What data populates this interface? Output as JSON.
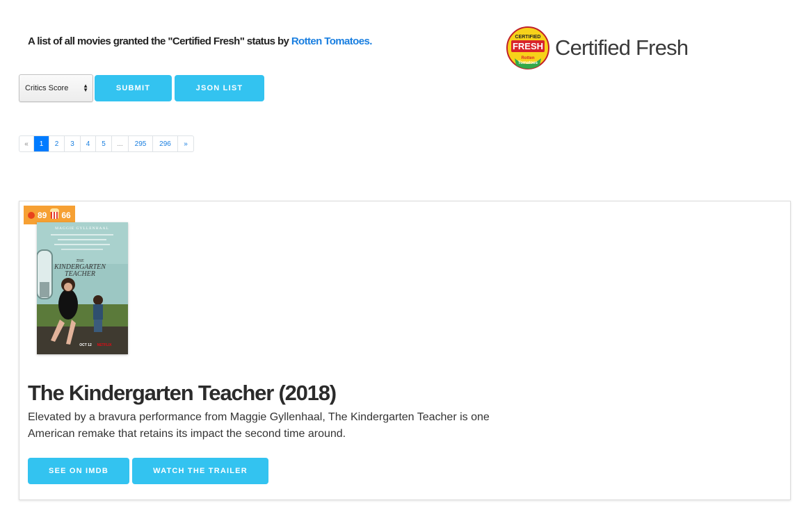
{
  "header": {
    "intro_text": "A list of all movies granted the \"Certified Fresh\" status by ",
    "intro_link": "Rotten Tomatoes.",
    "brand_title": "Certified Fresh",
    "badge": {
      "top": "CERTIFIED",
      "middle": "FRESH",
      "bottom1": "Rotten",
      "bottom2": "Tomatoes"
    }
  },
  "controls": {
    "sort_selected": "Critics Score",
    "submit_label": "Submit",
    "json_label": "JSON List"
  },
  "pagination": {
    "prev": "«",
    "pages": [
      "1",
      "2",
      "3",
      "4",
      "5"
    ],
    "ellipsis": "...",
    "last_pages": [
      "295",
      "296"
    ],
    "next": "»",
    "current": "1"
  },
  "movie": {
    "critics_score": "89",
    "audience_score": "66",
    "title": "The Kindergarten Teacher (2018)",
    "description": "Elevated by a bravura performance from Maggie Gyllenhaal, The Kindergarten Teacher is one American remake that retains its impact the second time around.",
    "imdb_label": "See on IMDB",
    "trailer_label": "Watch the trailer",
    "poster": {
      "actor": "MAGGIE GYLLENHAAL",
      "title_line1": "THE",
      "title_line2": "KINDERGARTEN",
      "title_line3": "TEACHER",
      "date": "OCT 12",
      "network": "NETFLIX"
    }
  },
  "colors": {
    "accent": "#33c3f0",
    "link": "#1a7fe0",
    "score_badge": "#f6a033",
    "page_active": "#007bff"
  }
}
